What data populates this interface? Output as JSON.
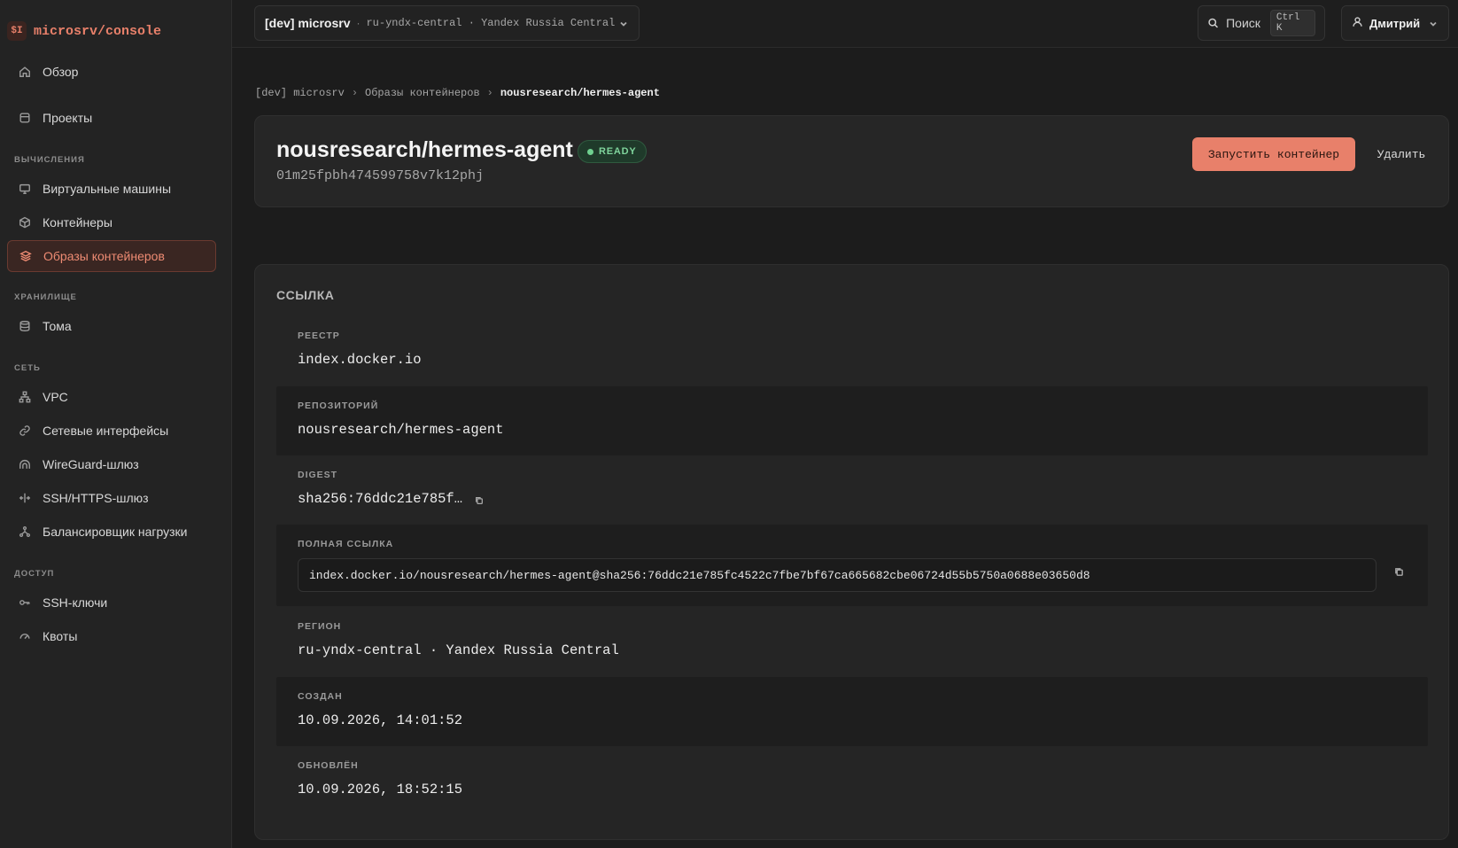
{
  "brand": {
    "logo": "$I",
    "name": "microsrv/console"
  },
  "sidebar": {
    "top_items": [
      {
        "label": "Обзор",
        "icon": "home-icon"
      },
      {
        "label": "Проекты",
        "icon": "folder-icon"
      }
    ],
    "sections": [
      {
        "label": "ВЫЧИСЛЕНИЯ",
        "items": [
          {
            "label": "Виртуальные машины",
            "icon": "monitor-icon"
          },
          {
            "label": "Контейнеры",
            "icon": "box-icon"
          },
          {
            "label": "Образы контейнеров",
            "icon": "layers-icon",
            "active": true
          }
        ]
      },
      {
        "label": "ХРАНИЛИЩЕ",
        "items": [
          {
            "label": "Тома",
            "icon": "database-icon"
          }
        ]
      },
      {
        "label": "СЕТЬ",
        "items": [
          {
            "label": "VPC",
            "icon": "network-icon"
          },
          {
            "label": "Сетевые интерфейсы",
            "icon": "link-icon"
          },
          {
            "label": "WireGuard-шлюз",
            "icon": "tunnel-icon"
          },
          {
            "label": "SSH/HTTPS-шлюз",
            "icon": "arrows-icon"
          },
          {
            "label": "Балансировщик нагрузки",
            "icon": "split-icon"
          }
        ]
      },
      {
        "label": "ДОСТУП",
        "items": [
          {
            "label": "SSH-ключи",
            "icon": "key-icon"
          },
          {
            "label": "Квоты",
            "icon": "gauge-icon"
          }
        ]
      }
    ]
  },
  "topbar": {
    "project": "[dev] microsrv",
    "separator": "·",
    "region": "ru-yndx-central · Yandex Russia Central",
    "search_label": "Поиск",
    "search_shortcut": "Ctrl K",
    "user_name": "Дмитрий"
  },
  "breadcrumb": {
    "items": [
      "[dev] microsrv",
      "Образы контейнеров"
    ],
    "current": "nousresearch/hermes-agent",
    "separator": "›"
  },
  "image": {
    "name": "nousresearch/hermes-agent",
    "status": "READY",
    "id": "01m25fpbh474599758v7k12phj",
    "run_button": "Запустить контейнер",
    "delete_button": "Удалить",
    "status_color": "#7fd49c",
    "accent_color": "#e8806a"
  },
  "details": {
    "title": "ССЫЛКА",
    "registry_label": "РЕЕСТР",
    "registry": "index.docker.io",
    "repository_label": "РЕПОЗИТОРИЙ",
    "repository": "nousresearch/hermes-agent",
    "digest_label": "DIGEST",
    "digest": "sha256:76ddc21e785f…",
    "fullref_label": "ПОЛНАЯ ССЫЛКА",
    "fullref": "index.docker.io/nousresearch/hermes-agent@sha256:76ddc21e785fc4522c7fbe7bf67ca665682cbe06724d55b5750a0688e03650d8",
    "region_label": "РЕГИОН",
    "region": "ru-yndx-central · Yandex Russia Central",
    "created_label": "СОЗДАН",
    "created": "10.09.2026, 14:01:52",
    "updated_label": "ОБНОВЛЁН",
    "updated": "10.09.2026, 18:52:15"
  }
}
